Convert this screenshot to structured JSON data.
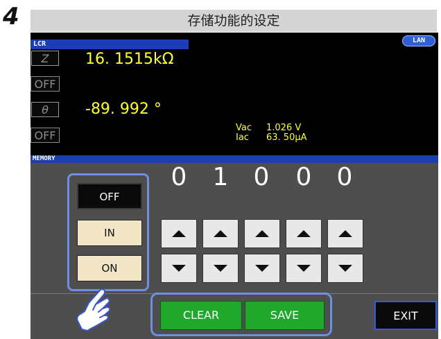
{
  "step": {
    "number": "4",
    "title": "存储功能的设定"
  },
  "header": {
    "section_label": "LCR",
    "lan_badge": "LAN"
  },
  "measurements": {
    "param1_symbol": "Z",
    "param1_value": "16. 1515kΩ",
    "param2_off": "OFF",
    "param3_symbol": "θ",
    "param3_value": "-89. 992 °",
    "param4_off": "OFF"
  },
  "monitor": {
    "vac_label": "Vac",
    "vac_value": "1.026 V",
    "iac_label": "Iac",
    "iac_value": "63. 50μA"
  },
  "memory": {
    "section_label": "MEMORY",
    "modes": [
      {
        "label": "OFF",
        "selected": true
      },
      {
        "label": "IN",
        "selected": false
      },
      {
        "label": "ON",
        "selected": false
      }
    ],
    "digits": [
      "0",
      "1",
      "0",
      "0",
      "0"
    ]
  },
  "actions": {
    "clear_label": "CLEAR",
    "save_label": "SAVE",
    "exit_label": "EXIT"
  },
  "icons": {
    "step_marker": "step-number",
    "pointer": "hand-pointer-icon",
    "increment": "up-arrow-icon",
    "decrement": "down-arrow-icon"
  },
  "colors": {
    "screen_background": "#000000",
    "panel_background": "#4e4e4e",
    "reading_text": "#ffff33",
    "header_bar": "#1c3fb0",
    "highlight_outline": "#6f8fe0",
    "action_green": "#1fa82b",
    "mode_button": "#f3e6c6"
  }
}
